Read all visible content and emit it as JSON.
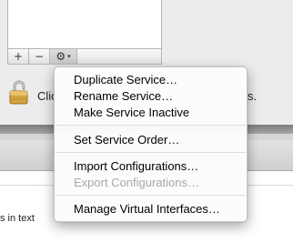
{
  "list_bar": {
    "add_label": "+",
    "remove_label": "−",
    "gear_label": "⚙",
    "gear_arrow": "▾"
  },
  "lock": {
    "text_prefix": "Clic",
    "text_suffix": "s."
  },
  "body_text": "s in text",
  "menu": {
    "groups": [
      {
        "items": [
          {
            "label": "Duplicate Service…",
            "enabled": true
          },
          {
            "label": "Rename Service…",
            "enabled": true
          },
          {
            "label": "Make Service Inactive",
            "enabled": true
          }
        ]
      },
      {
        "items": [
          {
            "label": "Set Service Order…",
            "enabled": true
          }
        ]
      },
      {
        "items": [
          {
            "label": "Import Configurations…",
            "enabled": true
          },
          {
            "label": "Export Configurations…",
            "enabled": false
          }
        ]
      },
      {
        "items": [
          {
            "label": "Manage Virtual Interfaces…",
            "enabled": true
          }
        ]
      }
    ]
  },
  "colors": {
    "disabled_text": "#a8a8a8",
    "menu_background": "#fcfcfc"
  }
}
